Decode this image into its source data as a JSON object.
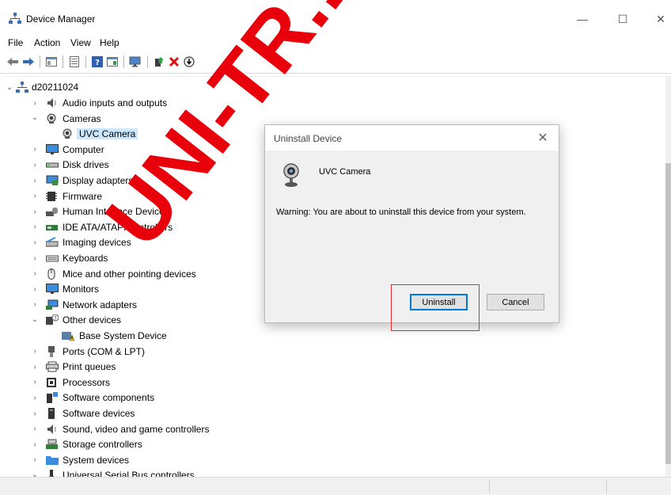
{
  "window": {
    "title": "Device Manager",
    "minimize_glyph": "—",
    "maximize_glyph": "☐",
    "close_glyph": "✕"
  },
  "menu": [
    "File",
    "Action",
    "View",
    "Help"
  ],
  "toolbar": {
    "icons": [
      "back-arrow-icon",
      "forward-arrow-icon",
      "show-hide-console-tree-icon",
      "properties-icon",
      "help-icon",
      "action-pane-icon",
      "scan-hardware-icon",
      "update-driver-icon",
      "uninstall-device-icon",
      "disable-device-icon"
    ]
  },
  "tree": {
    "root": "d20211024",
    "items": [
      {
        "label": "Audio inputs and outputs",
        "icon": "speaker-icon",
        "expanded": false
      },
      {
        "label": "Cameras",
        "icon": "camera-icon",
        "expanded": true
      },
      {
        "label": "UVC Camera",
        "icon": "webcam-icon",
        "child": true,
        "selected": true
      },
      {
        "label": "Computer",
        "icon": "monitor-icon",
        "expanded": false
      },
      {
        "label": "Disk drives",
        "icon": "disk-drive-icon",
        "expanded": false
      },
      {
        "label": "Display adapters",
        "icon": "display-adapter-icon",
        "expanded": false
      },
      {
        "label": "Firmware",
        "icon": "firmware-icon",
        "expanded": false
      },
      {
        "label": "Human Interface Devices",
        "icon": "hid-icon",
        "expanded": false
      },
      {
        "label": "IDE ATA/ATAPI controllers",
        "icon": "ide-controller-icon",
        "expanded": false
      },
      {
        "label": "Imaging devices",
        "icon": "scanner-icon",
        "expanded": false
      },
      {
        "label": "Keyboards",
        "icon": "keyboard-icon",
        "expanded": false
      },
      {
        "label": "Mice and other pointing devices",
        "icon": "mouse-icon",
        "expanded": false
      },
      {
        "label": "Monitors",
        "icon": "monitor-icon",
        "expanded": false
      },
      {
        "label": "Network adapters",
        "icon": "network-adapter-icon",
        "expanded": false
      },
      {
        "label": "Other devices",
        "icon": "unknown-device-icon",
        "expanded": true
      },
      {
        "label": "Base System Device",
        "icon": "warning-device-icon",
        "child": true
      },
      {
        "label": "Ports (COM & LPT)",
        "icon": "port-icon",
        "expanded": false
      },
      {
        "label": "Print queues",
        "icon": "printer-icon",
        "expanded": false
      },
      {
        "label": "Processors",
        "icon": "processor-icon",
        "expanded": false
      },
      {
        "label": "Software components",
        "icon": "software-component-icon",
        "expanded": false
      },
      {
        "label": "Software devices",
        "icon": "software-device-icon",
        "expanded": false
      },
      {
        "label": "Sound, video and game controllers",
        "icon": "speaker-icon",
        "expanded": false
      },
      {
        "label": "Storage controllers",
        "icon": "storage-controller-icon",
        "expanded": false
      },
      {
        "label": "System devices",
        "icon": "system-folder-icon",
        "expanded": false
      },
      {
        "label": "Universal Serial Bus controllers",
        "icon": "usb-icon",
        "expanded": true
      }
    ]
  },
  "dialog": {
    "title": "Uninstall Device",
    "device_name": "UVC Camera",
    "warning": "Warning: You are about to uninstall this device from your system.",
    "uninstall_label": "Uninstall",
    "cancel_label": "Cancel"
  },
  "watermark": {
    "text": "UNI-TR...",
    "color": "#e8000b"
  },
  "colors": {
    "selection": "#cce8ff",
    "accent": "#0078d7",
    "highlight_box": "#e8282e"
  }
}
